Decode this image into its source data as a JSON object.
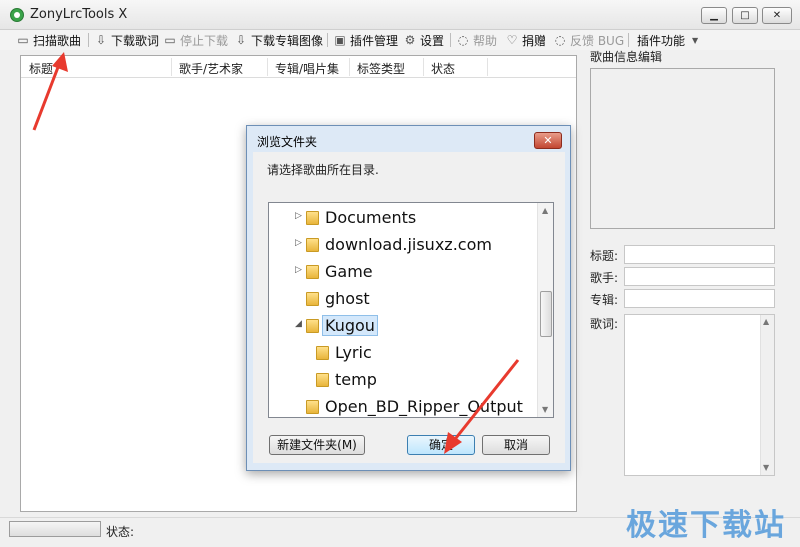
{
  "window": {
    "title": "ZonyLrcTools X",
    "min_glyph": "▁",
    "max_glyph": "□",
    "close_glyph": "✕"
  },
  "toolbar": {
    "scan": "扫描歌曲",
    "download_lyrics": "下载歌词",
    "stop_download": "停止下载",
    "download_album_art": "下载专辑图像",
    "plugin_manage": "插件管理",
    "settings": "设置",
    "help": "帮助",
    "donate": "捐赠",
    "feedback": "反馈 BUG",
    "plugin_functions": "插件功能"
  },
  "list": {
    "columns": [
      "标题",
      "歌手/艺术家",
      "专辑/唱片集",
      "标签类型",
      "状态"
    ]
  },
  "right_panel": {
    "title": "歌曲信息编辑",
    "label_title": "标题:",
    "label_artist": "歌手:",
    "label_album": "专辑:",
    "label_lyrics": "歌词:",
    "title_value": "",
    "artist_value": "",
    "album_value": "",
    "lyrics_value": ""
  },
  "dialog": {
    "title": "浏览文件夹",
    "prompt": "请选择歌曲所在目录.",
    "tree": [
      {
        "name": "Documents",
        "expander": "▷"
      },
      {
        "name": "download.jisuxz.com",
        "expander": "▷"
      },
      {
        "name": "Game",
        "expander": "▷"
      },
      {
        "name": "ghost",
        "expander": ""
      },
      {
        "name": "Kugou",
        "expander": "◢",
        "selected": true
      },
      {
        "name": "Lyric",
        "expander": ""
      },
      {
        "name": "temp",
        "expander": ""
      },
      {
        "name": "Open_BD_Ripper_Output",
        "expander": ""
      }
    ],
    "new_folder": "新建文件夹(M)",
    "ok": "确定",
    "cancel": "取消",
    "close_glyph": "✕"
  },
  "status": {
    "label": "状态:",
    "progress": 0
  },
  "watermark": "极速下载站",
  "colors": {
    "arrow": "#e83a2e",
    "watermark": "#6aa6dd"
  }
}
